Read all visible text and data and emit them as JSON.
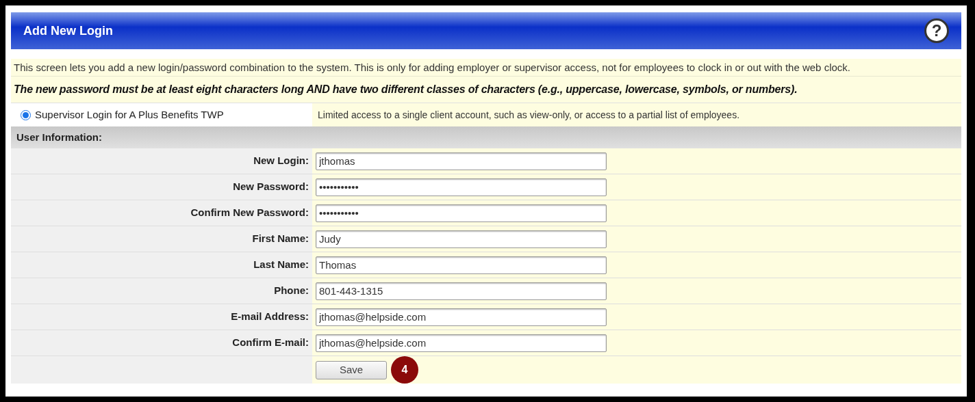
{
  "header": {
    "title": "Add New Login",
    "help_icon": "?"
  },
  "intro": "This screen lets you add a new login/password combination to the system. This is only for adding employer or supervisor access, not for employees to clock in or out with the web clock.",
  "password_rule": "The new password must be at least eight characters long AND have two different classes of characters (e.g., uppercase, lowercase, symbols, or numbers).",
  "login_types": [
    {
      "label": "Supervisor Login for A Plus Benefits TWP",
      "selected": true,
      "description": "Limited access to a single client account, such as view-only, or access to a partial list of employees."
    }
  ],
  "section_title": "User Information:",
  "fields": [
    {
      "label": "New Login:",
      "value": "jthomas"
    },
    {
      "label": "New Password:",
      "value": "•••••••••••"
    },
    {
      "label": "Confirm New Password:",
      "value": "•••••••••••"
    },
    {
      "label": "First Name:",
      "value": "Judy"
    },
    {
      "label": "Last Name:",
      "value": "Thomas"
    },
    {
      "label": "Phone:",
      "value": "801-443-1315"
    },
    {
      "label": "E-mail Address:",
      "value": "jthomas@helpside.com"
    },
    {
      "label": "Confirm E-mail:",
      "value": "jthomas@helpside.com"
    }
  ],
  "save_button": "Save",
  "step_badge": "4"
}
